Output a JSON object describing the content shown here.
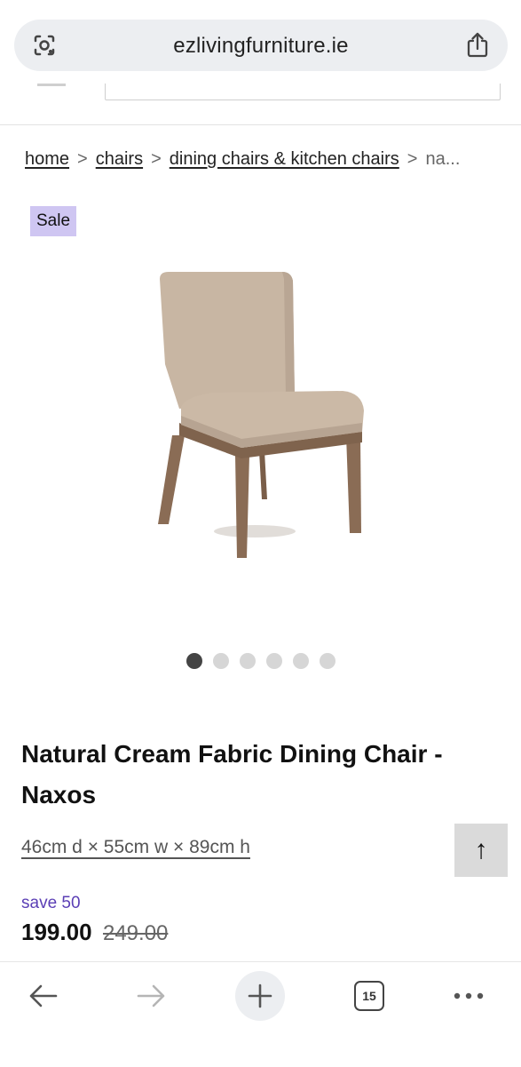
{
  "browser": {
    "url": "ezlivingfurniture.ie",
    "tabs_count": "15"
  },
  "breadcrumb": {
    "items": [
      "home",
      "chairs",
      "dining chairs & kitchen chairs"
    ],
    "separator": ">",
    "current": "na..."
  },
  "product": {
    "badge": "Sale",
    "title": "Natural Cream Fabric Dining Chair - Naxos",
    "dimensions": "46cm d × 55cm w × 89cm h",
    "save": "save 50",
    "price": "199.00",
    "was_price": "249.00",
    "image_count": 6,
    "active_image_index": 0
  },
  "back_to_top_label": "↑",
  "colors": {
    "badge_bg": "#cfc6f2",
    "save_text": "#5b3fb5",
    "chair_fabric": "#c9b7a4",
    "chair_wood": "#8a6c55"
  }
}
